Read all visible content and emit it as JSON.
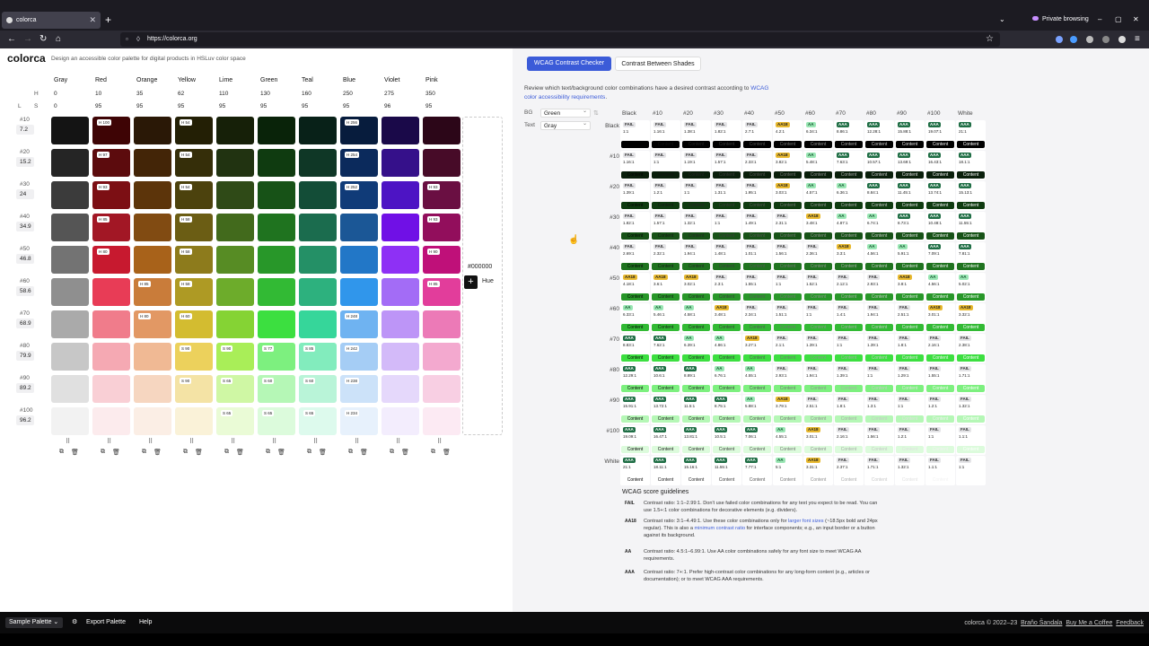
{
  "browser": {
    "tab_title": "colorca",
    "new_tab": "+",
    "private_label": "Private browsing",
    "url": "https://colorca.org",
    "controls": [
      "⌄",
      "–",
      "▢",
      "✕"
    ]
  },
  "app": {
    "logo": "colorca",
    "tagline": "Design an accessible color palette for digital products in HSLuv color space"
  },
  "columns": [
    "Gray",
    "Red",
    "Orange",
    "Yellow",
    "Lime",
    "Green",
    "Teal",
    "Blue",
    "Violet",
    "Pink"
  ],
  "hue_label": "H",
  "sat_label": "S",
  "l_label": "L",
  "hues": [
    "0",
    "10",
    "35",
    "62",
    "110",
    "130",
    "160",
    "250",
    "275",
    "350"
  ],
  "sats": [
    "0",
    "95",
    "95",
    "95",
    "95",
    "95",
    "95",
    "95",
    "96",
    "95"
  ],
  "shade_rows": [
    {
      "label": "#10",
      "value": "7.2"
    },
    {
      "label": "#20",
      "value": "15.2"
    },
    {
      "label": "#30",
      "value": "24"
    },
    {
      "label": "#40",
      "value": "34.9"
    },
    {
      "label": "#50",
      "value": "46.8"
    },
    {
      "label": "#60",
      "value": "58.6"
    },
    {
      "label": "#70",
      "value": "68.9"
    },
    {
      "label": "#80",
      "value": "79.9"
    },
    {
      "label": "#90",
      "value": "89.2"
    },
    {
      "label": "#100",
      "value": "96.2"
    }
  ],
  "palette": [
    [
      "#141414",
      "#3e0405",
      "#2a1806",
      "#231f05",
      "#162008",
      "#092309",
      "#082118",
      "#071c3d",
      "#1a0949",
      "#2c0618"
    ],
    [
      "#252525",
      "#5c0b0d",
      "#432507",
      "#352e09",
      "#213311",
      "#0f3b10",
      "#0f3726",
      "#0b2a5c",
      "#35108a",
      "#470b28"
    ],
    [
      "#3b3b3b",
      "#7c0f14",
      "#5c340a",
      "#4c420d",
      "#2f4a17",
      "#175217",
      "#134d37",
      "#103b78",
      "#4d14c4",
      "#6a0f42"
    ],
    [
      "#555",
      "#a21725",
      "#814b12",
      "#6b5d14",
      "#426a1c",
      "#1f731f",
      "#1b6c4e",
      "#1b5796",
      "#7010e6",
      "#920e5c"
    ],
    [
      "#737373",
      "#c7192f",
      "#a8621a",
      "#8d7b1c",
      "#578c24",
      "#289729",
      "#249066",
      "#2277c7",
      "#8e30f5",
      "#bf1079"
    ],
    [
      "#8f8f8f",
      "#e83c56",
      "#c97c3a",
      "#ae9a24",
      "#6dac2b",
      "#32ba34",
      "#2db17e",
      "#3096eb",
      "#a36cf6",
      "#e23d9b"
    ],
    [
      "#aaa",
      "#f07c8b",
      "#e29864",
      "#d3bc30",
      "#85d334",
      "#3cdf40",
      "#36d69a",
      "#6fb3f1",
      "#bd95f7",
      "#ec7ab7"
    ],
    [
      "#c7c7c7",
      "#f5a9b3",
      "#f0b994",
      "#ecd15c",
      "#a9ee58",
      "#7df07f",
      "#82ecbd",
      "#a5cdf5",
      "#d3baf9",
      "#f3a9cf"
    ],
    [
      "#e0e0e0",
      "#f9cfd5",
      "#f6d6c0",
      "#f4e3a5",
      "#cff7a4",
      "#b5f7b6",
      "#b9f4d8",
      "#cce2f9",
      "#e5d8fb",
      "#f8cfe3"
    ],
    [
      "#f2f2f2",
      "#fcebed",
      "#fbeee5",
      "#faf2d8",
      "#eafbd6",
      "#dcfbdc",
      "#ddfaed",
      "#e7f1fc",
      "#f3edfd",
      "#fceaf3"
    ]
  ],
  "swatch_badges": [
    {
      "r": 0,
      "c": 7,
      "t": "H 256"
    },
    {
      "r": 0,
      "c": 1,
      "t": "H 100"
    },
    {
      "r": 0,
      "c": 3,
      "t": "H 54"
    },
    {
      "r": 1,
      "c": 1,
      "t": "H 97"
    },
    {
      "r": 1,
      "c": 3,
      "t": "H 54"
    },
    {
      "r": 1,
      "c": 7,
      "t": "H 254"
    },
    {
      "r": 2,
      "c": 1,
      "t": "H 93"
    },
    {
      "r": 2,
      "c": 3,
      "t": "H 54"
    },
    {
      "r": 2,
      "c": 7,
      "t": "H 252"
    },
    {
      "r": 2,
      "c": 9,
      "t": "H 93"
    },
    {
      "r": 3,
      "c": 1,
      "t": "H 85"
    },
    {
      "r": 3,
      "c": 3,
      "t": "H 58"
    },
    {
      "r": 3,
      "c": 9,
      "t": "H 93"
    },
    {
      "r": 4,
      "c": 1,
      "t": "H 80"
    },
    {
      "r": 4,
      "c": 3,
      "t": "H 58"
    },
    {
      "r": 4,
      "c": 9,
      "t": "H 90"
    },
    {
      "r": 5,
      "c": 2,
      "t": "H 85"
    },
    {
      "r": 5,
      "c": 3,
      "t": "H 58"
    },
    {
      "r": 5,
      "c": 9,
      "t": "H 85"
    },
    {
      "r": 6,
      "c": 2,
      "t": "H 80"
    },
    {
      "r": 6,
      "c": 3,
      "t": "H 60"
    },
    {
      "r": 6,
      "c": 7,
      "t": "H 248"
    },
    {
      "r": 7,
      "c": 3,
      "t": "S 90"
    },
    {
      "r": 7,
      "c": 4,
      "t": "S 90"
    },
    {
      "r": 7,
      "c": 5,
      "t": "S 77"
    },
    {
      "r": 7,
      "c": 6,
      "t": "S 85"
    },
    {
      "r": 7,
      "c": 7,
      "t": "H 242"
    },
    {
      "r": 8,
      "c": 3,
      "t": "S 90"
    },
    {
      "r": 8,
      "c": 4,
      "t": "S 65"
    },
    {
      "r": 8,
      "c": 5,
      "t": "S 60"
    },
    {
      "r": 8,
      "c": 6,
      "t": "S 60"
    },
    {
      "r": 8,
      "c": 7,
      "t": "H 238"
    },
    {
      "r": 9,
      "c": 4,
      "t": "S 65"
    },
    {
      "r": 9,
      "c": 5,
      "t": "S 65"
    },
    {
      "r": 9,
      "c": 6,
      "t": "S 65"
    },
    {
      "r": 9,
      "c": 7,
      "t": "H 234"
    }
  ],
  "hex_label": "#000000",
  "hue_button": "Hue",
  "checker": {
    "tab_active": "WCAG Contrast Checker",
    "tab_other": "Contrast Between Shades",
    "desc_pre": "Review which text/background color combinations have a desired contrast according to ",
    "desc_link": "WCAG color accessibility requirements",
    "desc_post": ".",
    "bg_label": "BG",
    "bg_value": "Green",
    "text_label": "Text",
    "text_value": "Gray",
    "col_heads": [
      "Black",
      "#10",
      "#20",
      "#30",
      "#40",
      "#50",
      "#60",
      "#70",
      "#80",
      "#90",
      "#100",
      "White"
    ],
    "row_heads": [
      "Black",
      "#10",
      "#20",
      "#30",
      "#40",
      "#50",
      "#60",
      "#70",
      "#80",
      "#90",
      "#100",
      "White"
    ],
    "cell_text": "Content",
    "ratios": [
      [
        "1:1",
        "1.16:1",
        "1.38:1",
        "1.82:1",
        "2.7:1",
        "4.2:1",
        "6.34:1",
        "8.86:1",
        "12.28:1",
        "15.88:1",
        "19.07:1",
        "21:1"
      ],
      [
        "1.16:1",
        "1:1",
        "1.19:1",
        "1.57:1",
        "2.33:1",
        "3.82:1",
        "5.48:1",
        "7.63:1",
        "10.57:1",
        "13.69:1",
        "16.43:1",
        "18.1:1"
      ],
      [
        "1.39:1",
        "1.2:1",
        "1:1",
        "1.31:1",
        "1.95:1",
        "3.03:1",
        "4.57:1",
        "6.36:1",
        "8.84:1",
        "11.45:1",
        "13.74:1",
        "15.13:1"
      ],
      [
        "1.82:1",
        "1.57:1",
        "1.32:1",
        "1:1",
        "1.49:1",
        "2.31:1",
        "3.48:1",
        "4.87:1",
        "6.74:1",
        "8.73:1",
        "10.48:1",
        "11.55:1"
      ],
      [
        "2.69:1",
        "2.32:1",
        "1.94:1",
        "1.48:1",
        "1.01:1",
        "1.56:1",
        "2.36:1",
        "3.3:1",
        "4.56:1",
        "5.91:1",
        "7.09:1",
        "7.81:1"
      ],
      [
        "4.18:1",
        "3.6:1",
        "3.02:1",
        "2.3:1",
        "1.55:1",
        "1:1",
        "1.52:1",
        "2.12:1",
        "2.93:1",
        "3.8:1",
        "4.56:1",
        "5.02:1"
      ],
      [
        "6.33:1",
        "5.46:1",
        "4.58:1",
        "3.48:1",
        "2.34:1",
        "1.51:1",
        "1:1",
        "1.4:1",
        "1.94:1",
        "2.51:1",
        "3.01:1",
        "3.32:1"
      ],
      [
        "8.83:1",
        "7.62:1",
        "6.39:1",
        "4.86:1",
        "3.27:1",
        "2.1:1",
        "1.39:1",
        "1:1",
        "1.39:1",
        "1.8:1",
        "2.16:1",
        "2.38:1"
      ],
      [
        "12.29:1",
        "10.6:1",
        "8.89:1",
        "6.76:1",
        "4.55:1",
        "2.93:1",
        "1.94:1",
        "1.39:1",
        "1:1",
        "1.29:1",
        "1.55:1",
        "1.71:1"
      ],
      [
        "15.91:1",
        "13.72:1",
        "11.5:1",
        "8.75:1",
        "5.88:1",
        "3.79:1",
        "2.51:1",
        "1.8:1",
        "1.3:1",
        "1:1",
        "1.2:1",
        "1.32:1"
      ],
      [
        "19.09:1",
        "16.47:1",
        "13.81:1",
        "10.5:1",
        "7.06:1",
        "4.55:1",
        "3.01:1",
        "2.16:1",
        "1.56:1",
        "1.2:1",
        "1:1",
        "1.1:1"
      ],
      [
        "21:1",
        "18.11:1",
        "15.16:1",
        "11.55:1",
        "7.77:1",
        "5:1",
        "3.31:1",
        "2.37:1",
        "1.71:1",
        "1.32:1",
        "1.1:1",
        "1:1"
      ]
    ],
    "bg_colors": [
      "#000000",
      "#0a1f0b",
      "#0f3b10",
      "#175217",
      "#1f731f",
      "#289729",
      "#32ba34",
      "#3cdf40",
      "#7df07f",
      "#b5f7b6",
      "#dcfbdc",
      "#ffffff"
    ],
    "text_colors": [
      "#000000",
      "#141414",
      "#252525",
      "#3b3b3b",
      "#555555",
      "#737373",
      "#8f8f8f",
      "#aaaaaa",
      "#c7c7c7",
      "#e0e0e0",
      "#f2f2f2",
      "#ffffff"
    ]
  },
  "guide": {
    "title": "WCAG score guidelines",
    "items": [
      {
        "badge": "FAIL",
        "cls": "fail",
        "text": "Contrast ratio: 1:1–2.99:1. Don't use failed color combinations for any text you expect to be read. You can use 1.5+:1 color combinations for decorative elements (e.g. dividers)."
      },
      {
        "badge": "AA18",
        "cls": "aa18",
        "text_pre": "Contrast ratio: 3:1–4.49:1. Use these color combinations only for ",
        "link1": "larger font sizes",
        "text_mid": " (~18.5px bold and 24px regular). This is also a ",
        "link2": "minimum contrast ratio",
        "text_post": " for interface components; e.g., an input border or a button against its background."
      },
      {
        "badge": "AA",
        "cls": "aa",
        "text": "Contrast ratio: 4.5:1–6.99:1. Use AA color combinations safely for any font size to meet WCAG AA requirements."
      },
      {
        "badge": "AAA",
        "cls": "aaa",
        "text": "Contrast ratio: 7+:1. Prefer high-contrast color combinations for any long-form content (e.g., articles or documentation); or to meet WCAG AAA requirements."
      }
    ]
  },
  "bottom": {
    "palette_select": "Sample Palette",
    "gear": "⚙",
    "export": "Export Palette",
    "help": "Help",
    "footer_copy": "colorca © 2022–23",
    "footer_author": "Braňo Šandala",
    "footer_coffee": "Buy Me a Coffee",
    "footer_feedback": "Feedback"
  }
}
